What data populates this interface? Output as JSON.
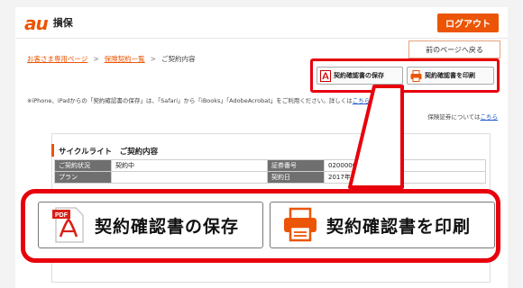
{
  "header": {
    "logo_mark": "au",
    "logo_text": "損保",
    "logout_label": "ログアウト"
  },
  "nav": {
    "back_label": "前のページへ戻る"
  },
  "breadcrumb": {
    "items": [
      "お客さま専用ページ",
      "保険契約一覧",
      "ご契約内容"
    ],
    "separator": ">"
  },
  "actions": {
    "save_label": "契約確認書の保存",
    "print_label": "契約確認書を印刷"
  },
  "notes": {
    "main_text": "※iPhone、iPadからの「契約確認書の保存」は、「Safari」から「iBooks」「AdobeAcrobat」をご利用ください。詳しくは",
    "faq_link": "こちら(FAQ)",
    "secondary_text": "保険証券については",
    "secondary_link": "こちら"
  },
  "contract": {
    "title": "サイクルライト　ご契約内容",
    "rows": [
      {
        "label1": "ご契約状況",
        "value1": "契約中",
        "label2": "証券番号",
        "value2": "020000631　　00000"
      },
      {
        "label1": "プラン",
        "value1": "",
        "label2": "契約日",
        "value2": "2017年0"
      }
    ]
  },
  "callout": {
    "save_label": "契約確認書の保存",
    "print_label": "契約確認書を印刷",
    "pdf_icon_text": "PDF"
  },
  "colors": {
    "brand_orange": "#eb5505",
    "highlight_red": "#e8000b",
    "link_blue": "#1a55c8"
  }
}
